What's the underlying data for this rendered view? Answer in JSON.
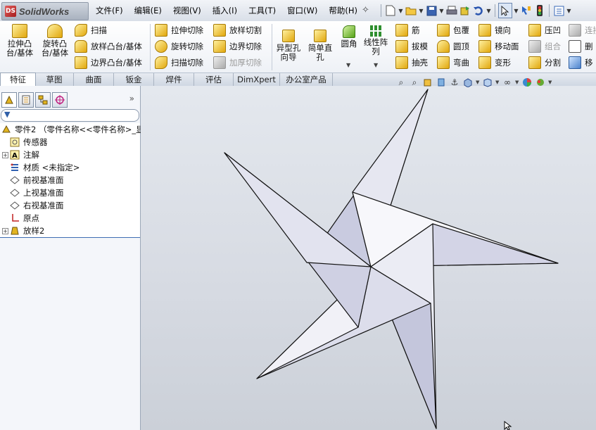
{
  "app": {
    "logo_ds": "DS",
    "logo_text": "SolidWorks"
  },
  "menu": [
    "文件(F)",
    "编辑(E)",
    "视图(V)",
    "插入(I)",
    "工具(T)",
    "窗口(W)",
    "帮助(H)"
  ],
  "quick_tools": [
    "pin-icon",
    "new-document-icon",
    "open-icon",
    "save-icon",
    "print-icon",
    "rebuild-icon",
    "undo-icon",
    "select-icon",
    "smart-select-icon",
    "traffic-light-icon",
    "options-icon"
  ],
  "commands": {
    "extrude_boss": "拉伸凸\n台/基体",
    "revolve_boss": "旋转凸\n台/基体",
    "sweep": "扫描",
    "loft_boss": "放样凸台/基体",
    "boundary_boss": "边界凸台/基体",
    "extrude_cut": "拉伸切除",
    "revolve_cut": "旋转切除",
    "sweep_cut": "扫描切除",
    "loft_cut": "放样切割",
    "boundary_cut": "边界切除",
    "thicken_cut": "加厚切除",
    "hole_wizard": "异型孔\n向导",
    "simple_hole": "简单直\n孔",
    "fillet": "圆角",
    "linear_pattern": "线性阵\n列",
    "rib": "筋",
    "draft": "拔模",
    "shell": "抽壳",
    "wrap": "包覆",
    "dome": "圆顶",
    "flex": "弯曲",
    "mirror": "镜向",
    "move_face": "移动面",
    "deform": "变形",
    "indent": "压凹",
    "combine": "组合",
    "split": "分割",
    "connect": "连接",
    "delete": "删",
    "move": "移"
  },
  "tabs": [
    "特征",
    "草图",
    "曲面",
    "钣金",
    "焊件",
    "评估",
    "DimXpert",
    "办公室产品"
  ],
  "active_tab": "特征",
  "panel": {
    "tab_icons": [
      "feature-manager-icon",
      "property-manager-icon",
      "configuration-manager-icon",
      "dimxpert-manager-icon"
    ],
    "collapse": "»",
    "filter_icon": "funnel-icon"
  },
  "tree": [
    {
      "name": "零件2 （零件名称<<零件名称>_显",
      "icon": "part-icon",
      "expander": false,
      "indent": 0
    },
    {
      "name": "传感器",
      "icon": "sensor-icon",
      "expander": false,
      "indent": 1
    },
    {
      "name": "注解",
      "icon": "annotation-icon",
      "expander": true,
      "indent": 1
    },
    {
      "name": "材质 <未指定>",
      "icon": "material-icon",
      "expander": false,
      "indent": 1
    },
    {
      "name": "前视基准面",
      "icon": "plane-icon",
      "expander": false,
      "indent": 1
    },
    {
      "name": "上视基准面",
      "icon": "plane-icon",
      "expander": false,
      "indent": 1
    },
    {
      "name": "右视基准面",
      "icon": "plane-icon",
      "expander": false,
      "indent": 1
    },
    {
      "name": "原点",
      "icon": "origin-icon",
      "expander": false,
      "indent": 1
    },
    {
      "name": "放样2",
      "icon": "loft-feature-icon",
      "expander": true,
      "indent": 1
    }
  ],
  "heads_up_toolbar": [
    "zoom-to-fit-icon",
    "zoom-area-icon",
    "previous-view-icon",
    "section-view-icon",
    "view-orientation-icon",
    "display-style-icon",
    "hide-show-icon",
    "edit-appearance-icon",
    "apply-scene-icon"
  ],
  "model": {
    "name": "five-point-star",
    "fill": "#dfe1ee",
    "edge": "#111111"
  }
}
